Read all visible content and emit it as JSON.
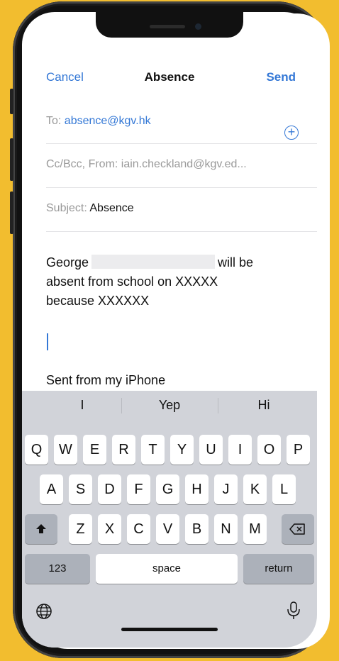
{
  "nav": {
    "cancel": "Cancel",
    "title": "Absence",
    "send": "Send"
  },
  "fields": {
    "to_label": "To:",
    "to_value": "absence@kgv.hk",
    "ccbcc_label": "Cc/Bcc, From:",
    "from_value": "iain.checkland@kgv.ed...",
    "subject_label": "Subject:",
    "subject_value": "Absence"
  },
  "body": {
    "line1_start": "George",
    "line1_end": "will be",
    "line2": "absent from school on XXXXX",
    "line3": "because XXXXXX",
    "signature": "Sent from my iPhone"
  },
  "keyboard": {
    "suggestions": [
      "I",
      "Yep",
      "Hi"
    ],
    "row1": [
      "Q",
      "W",
      "E",
      "R",
      "T",
      "Y",
      "U",
      "I",
      "O",
      "P"
    ],
    "row2": [
      "A",
      "S",
      "D",
      "F",
      "G",
      "H",
      "J",
      "K",
      "L"
    ],
    "row3": [
      "Z",
      "X",
      "C",
      "V",
      "B",
      "N",
      "M"
    ],
    "numbers_key": "123",
    "space_key": "space",
    "return_key": "return"
  },
  "colors": {
    "accent": "#3478d6",
    "background": "#f2bd2f"
  }
}
